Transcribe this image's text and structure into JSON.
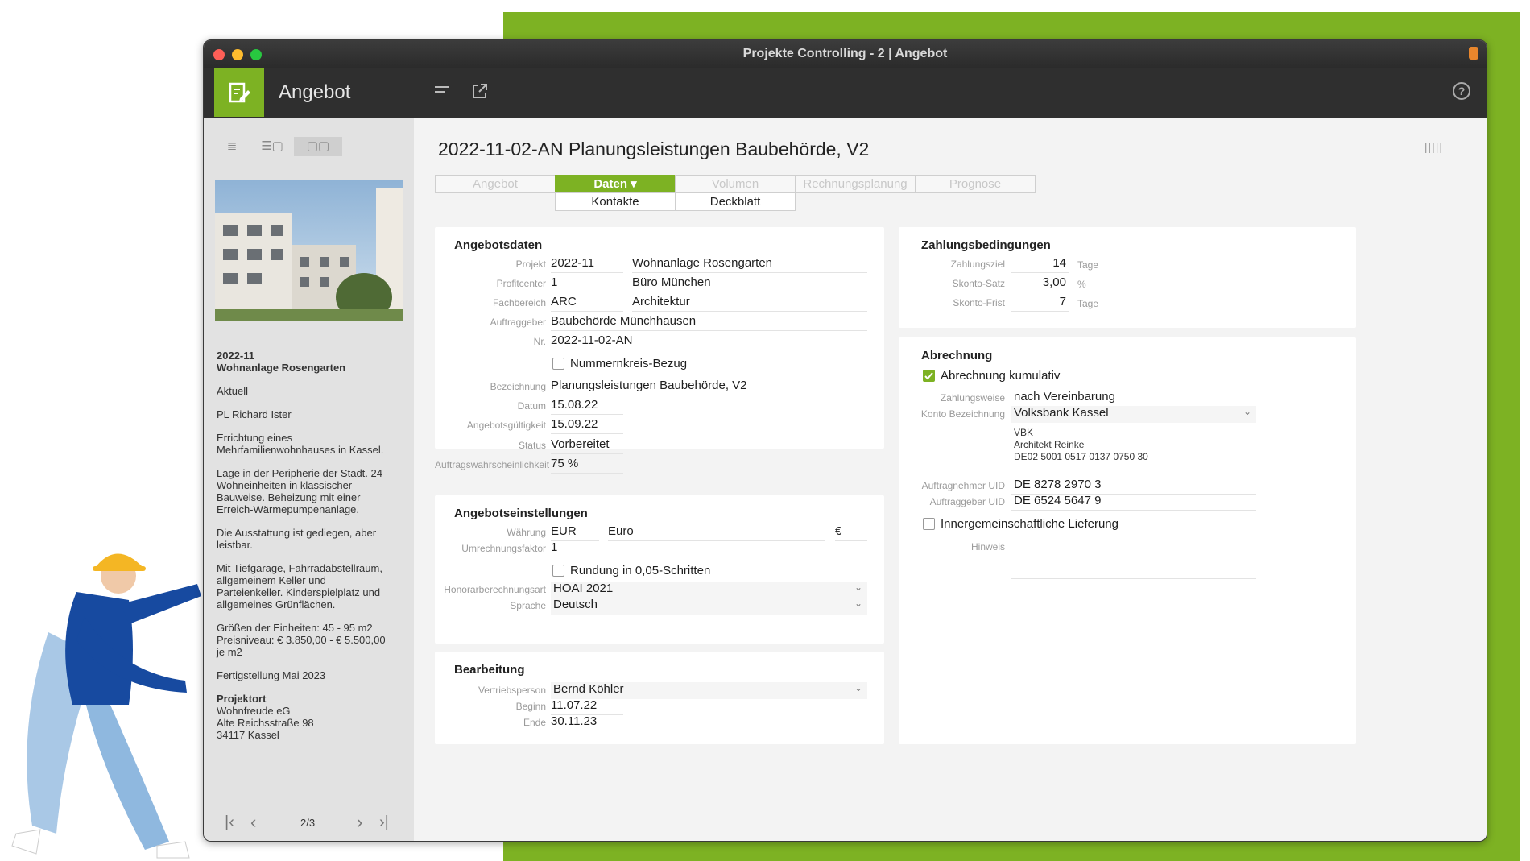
{
  "window": {
    "title": "Projekte Controlling - 2 | Angebot"
  },
  "toolbar": {
    "title": "Angebot"
  },
  "sidebar": {
    "pager": "2/3",
    "blocks": [
      {
        "lines": [
          "2022-11",
          "Wohnanlage Rosengarten"
        ],
        "bold": true
      },
      {
        "lines": [
          "Aktuell"
        ]
      },
      {
        "lines": [
          "PL Richard Ister"
        ]
      },
      {
        "lines": [
          "Errichtung eines",
          "Mehrfamilienwohnhauses in Kassel."
        ]
      },
      {
        "lines": [
          "Lage in der Peripherie der Stadt. 24",
          "Wohneinheiten in klassischer",
          "Bauweise. Beheizung mit einer",
          "Erreich-Wärmepumpenanlage."
        ]
      },
      {
        "lines": [
          "Die Ausstattung ist gediegen, aber",
          "leistbar."
        ]
      },
      {
        "lines": [
          "Mit Tiefgarage, Fahrradabstellraum,",
          "allgemeinem Keller und",
          "Parteienkeller. Kinderspielplatz und",
          "allgemeines Grünflächen."
        ]
      },
      {
        "lines": [
          "Größen der Einheiten: 45 - 95 m2",
          "Preisniveau: € 3.850,00 - € 5.500,00",
          "je m2"
        ]
      },
      {
        "lines": [
          "Fertigstellung Mai 2023"
        ]
      },
      {
        "lines": [
          "Projektort",
          "Wohnfreude eG",
          "Alte Reichsstraße 98",
          "34117 Kassel"
        ],
        "firstBold": true
      }
    ]
  },
  "record": {
    "title": "2022-11-02-AN Planungsleistungen Baubehörde, V2"
  },
  "tabs": {
    "main": [
      "Angebot",
      "Daten ▾",
      "Volumen",
      "Rechnungsplanung",
      "Prognose"
    ],
    "sub": [
      "Kontakte",
      "Deckblatt"
    ]
  },
  "angebotsdaten": {
    "heading": "Angebotsdaten",
    "projekt_label": "Projekt",
    "projekt_nr": "2022-11",
    "projekt_name": "Wohnanlage Rosengarten",
    "profitcenter_label": "Profitcenter",
    "profitcenter_nr": "1",
    "profitcenter_name": "Büro München",
    "fachbereich_label": "Fachbereich",
    "fachbereich_code": "ARC",
    "fachbereich_name": "Architektur",
    "auftraggeber_label": "Auftraggeber",
    "auftraggeber": "Baubehörde Münchhausen",
    "nr_label": "Nr.",
    "nr": "2022-11-02-AN",
    "nummernkreis": "Nummernkreis-Bezug",
    "bezeichnung_label": "Bezeichnung",
    "bezeichnung": "Planungsleistungen Baubehörde, V2",
    "datum_label": "Datum",
    "datum": "15.08.22",
    "gueltig_label": "Angebotsgültigkeit",
    "gueltig": "15.09.22",
    "status_label": "Status",
    "status": "Vorbereitet",
    "wahrsch_label": "Auftragswahrscheinlichkeit",
    "wahrsch": "75 %"
  },
  "einstellungen": {
    "heading": "Angebotseinstellungen",
    "waehrung_label": "Währung",
    "waehrung_code": "EUR",
    "waehrung_name": "Euro",
    "waehrung_symbol": "€",
    "umrechnung_label": "Umrechnungsfaktor",
    "umrechnung": "1",
    "rundung": "Rundung in 0,05-Schritten",
    "honorar_label": "Honorarberechnungsart",
    "honorar": "HOAI 2021",
    "sprache_label": "Sprache",
    "sprache": "Deutsch"
  },
  "bearbeitung": {
    "heading": "Bearbeitung",
    "vertrieb_label": "Vertriebsperson",
    "vertrieb": "Bernd Köhler",
    "beginn_label": "Beginn",
    "beginn": "11.07.22",
    "ende_label": "Ende",
    "ende": "30.11.23"
  },
  "zahlung": {
    "heading": "Zahlungsbedingungen",
    "ziel_label": "Zahlungsziel",
    "ziel": "14",
    "ziel_unit": "Tage",
    "skonto_label": "Skonto-Satz",
    "skonto": "3,00",
    "skonto_unit": "%",
    "frist_label": "Skonto-Frist",
    "frist": "7",
    "frist_unit": "Tage"
  },
  "abrechnung": {
    "heading": "Abrechnung",
    "kumulativ": "Abrechnung kumulativ",
    "weise_label": "Zahlungsweise",
    "weise": "nach Vereinbarung",
    "konto_label": "Konto Bezeichnung",
    "konto": "Volksbank Kassel",
    "konto_info": [
      "VBK",
      "Architekt Reinke",
      "DE02 5001 0517 0137 0750 30"
    ],
    "an_uid_label": "Auftragnehmer UID",
    "an_uid": "DE 8278 2970 3",
    "ag_uid_label": "Auftraggeber UID",
    "ag_uid": "DE 6524 5647 9",
    "innergem": "Innergemeinschaftliche Lieferung",
    "hinweis_label": "Hinweis"
  },
  "colors": {
    "accent": "#7db223",
    "toolbar": "#2f2f2f"
  }
}
